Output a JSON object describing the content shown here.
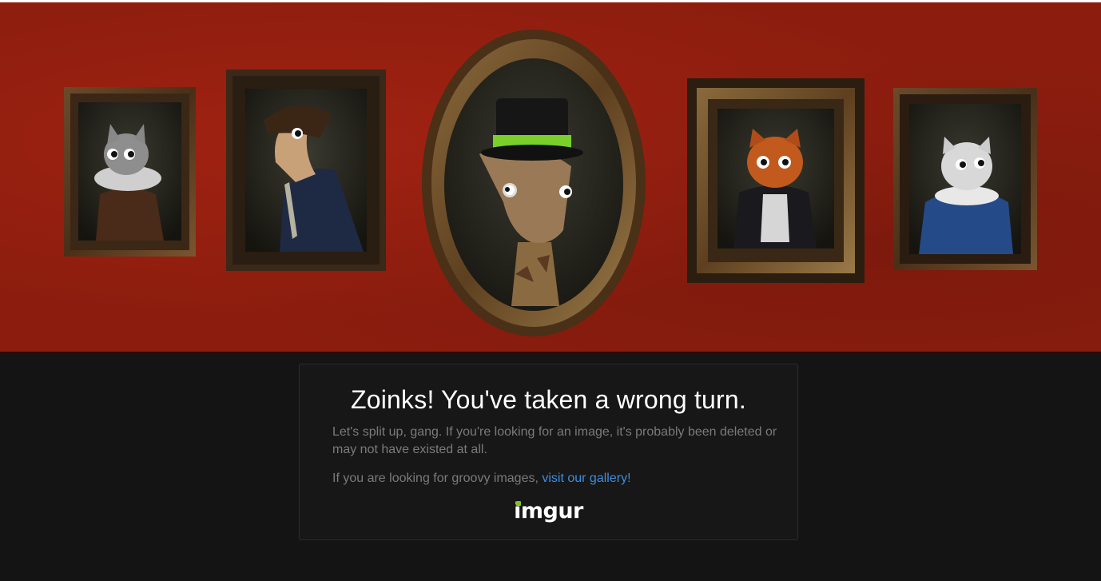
{
  "banner": {
    "portraits": [
      "gray-cat",
      "horse",
      "giraffe",
      "orange-cat",
      "white-cat"
    ]
  },
  "error": {
    "heading": "Zoinks! You've taken a wrong turn.",
    "message": "Let's split up, gang. If you're looking for an image, it's probably been deleted or may not have existed at all.",
    "gallery_prefix": "If you are looking for groovy images, ",
    "gallery_link": "visit our gallery!"
  },
  "logo": {
    "text": "imgur",
    "accent_color": "#85bf25"
  },
  "colors": {
    "banner_red": "#8c1d0e",
    "background": "#141414",
    "link": "#3f8de0"
  }
}
